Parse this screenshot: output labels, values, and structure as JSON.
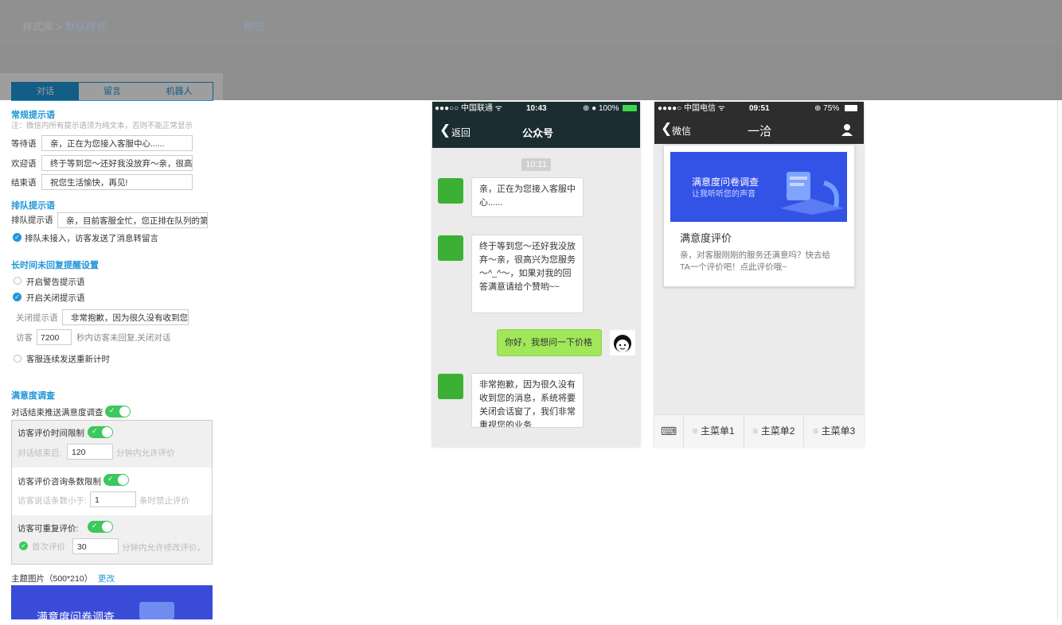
{
  "header": {
    "crumb_root": "样式库",
    "crumb_sep": ">",
    "crumb_current": "默认样式",
    "preview": "预览"
  },
  "tabs": [
    "对话",
    "留言",
    "机器人"
  ],
  "regular": {
    "title": "常规提示语",
    "note": "注：微信内所有提示语须为纯文本，否则不能正常显示",
    "fields": [
      {
        "label": "等待语",
        "value": "亲，正在为您接入客服中心......"
      },
      {
        "label": "欢迎语",
        "value": "终于等到您～还好我没放弃～亲，很高"
      },
      {
        "label": "结束语",
        "value": "祝您生活愉快，再见!"
      }
    ]
  },
  "queue": {
    "title": "排队提示语",
    "label": "排队提示语",
    "value": "亲，目前客服全忙，您正排在队列的第",
    "check_label": "排队未接入，访客发送了消息转留言"
  },
  "noreply": {
    "title": "长时间未回复提醒设置",
    "opt1": "开启警告提示语",
    "opt2": "开启关闭提示语",
    "close_label": "关闭提示语",
    "close_value": "非常抱歉，因为很久没有收到您",
    "visitor_label": "访客",
    "visitor_value": "7200",
    "visitor_suffix": "秒内访客未回复,关闭对话",
    "opt3": "客服连续发送重新计时"
  },
  "satisfaction": {
    "title": "满意度调查",
    "push_label": "对话结束推送满意度调查",
    "toggle_mark": "✓",
    "time_limit": "访客评价时间限制",
    "time_prefix": "对话结束后:",
    "time_value": "120",
    "time_suffix": "分钟内允许评价",
    "count_limit": "访客评价咨询条数限制",
    "count_prefix": "访客说话条数小于:",
    "count_value": "1",
    "count_suffix": "条时禁止评价",
    "repeat": "访客可重复评价:",
    "first_label": "首次评价",
    "first_value": "30",
    "first_suffix": "分钟内允许修改评价。"
  },
  "theme": {
    "label": "主题图片（500*210）",
    "change": "更改",
    "banner_text": "满意度问卷调查"
  },
  "phone1": {
    "status_carrier": "●●●○○ 中国联通 ᯤ",
    "status_time": "10:43",
    "status_battery": "⊕ ● 100%",
    "back": "返回",
    "title": "公众号",
    "time_tag": "10:11",
    "messages": [
      "亲，正在为您接入客服中心......",
      "终于等到您～还好我没放弃～亲，很高兴为您服务～^_^～，如果对我的回答满意请给个赞哟~~",
      "你好，我想问一下价格",
      "非常抱歉，因为很久没有收到您的消息，系统将要关闭会话窗了，我们非常重视您的业务"
    ]
  },
  "phone2": {
    "status_carrier": "●●●●○ 中国电信 ᯤ",
    "status_time": "09:51",
    "status_battery": "⊕ 75%",
    "back": "微信",
    "title": "一洽",
    "banner_title": "满意度问卷调查",
    "banner_sub": "让我听听您的声音",
    "card_title": "满意度评价",
    "card_desc": "亲，对客服刚刚的服务还满意吗？快去给TA一个评价吧！点此评价哦~",
    "menus": [
      "主菜单1",
      "主菜单2",
      "主菜单3"
    ]
  }
}
